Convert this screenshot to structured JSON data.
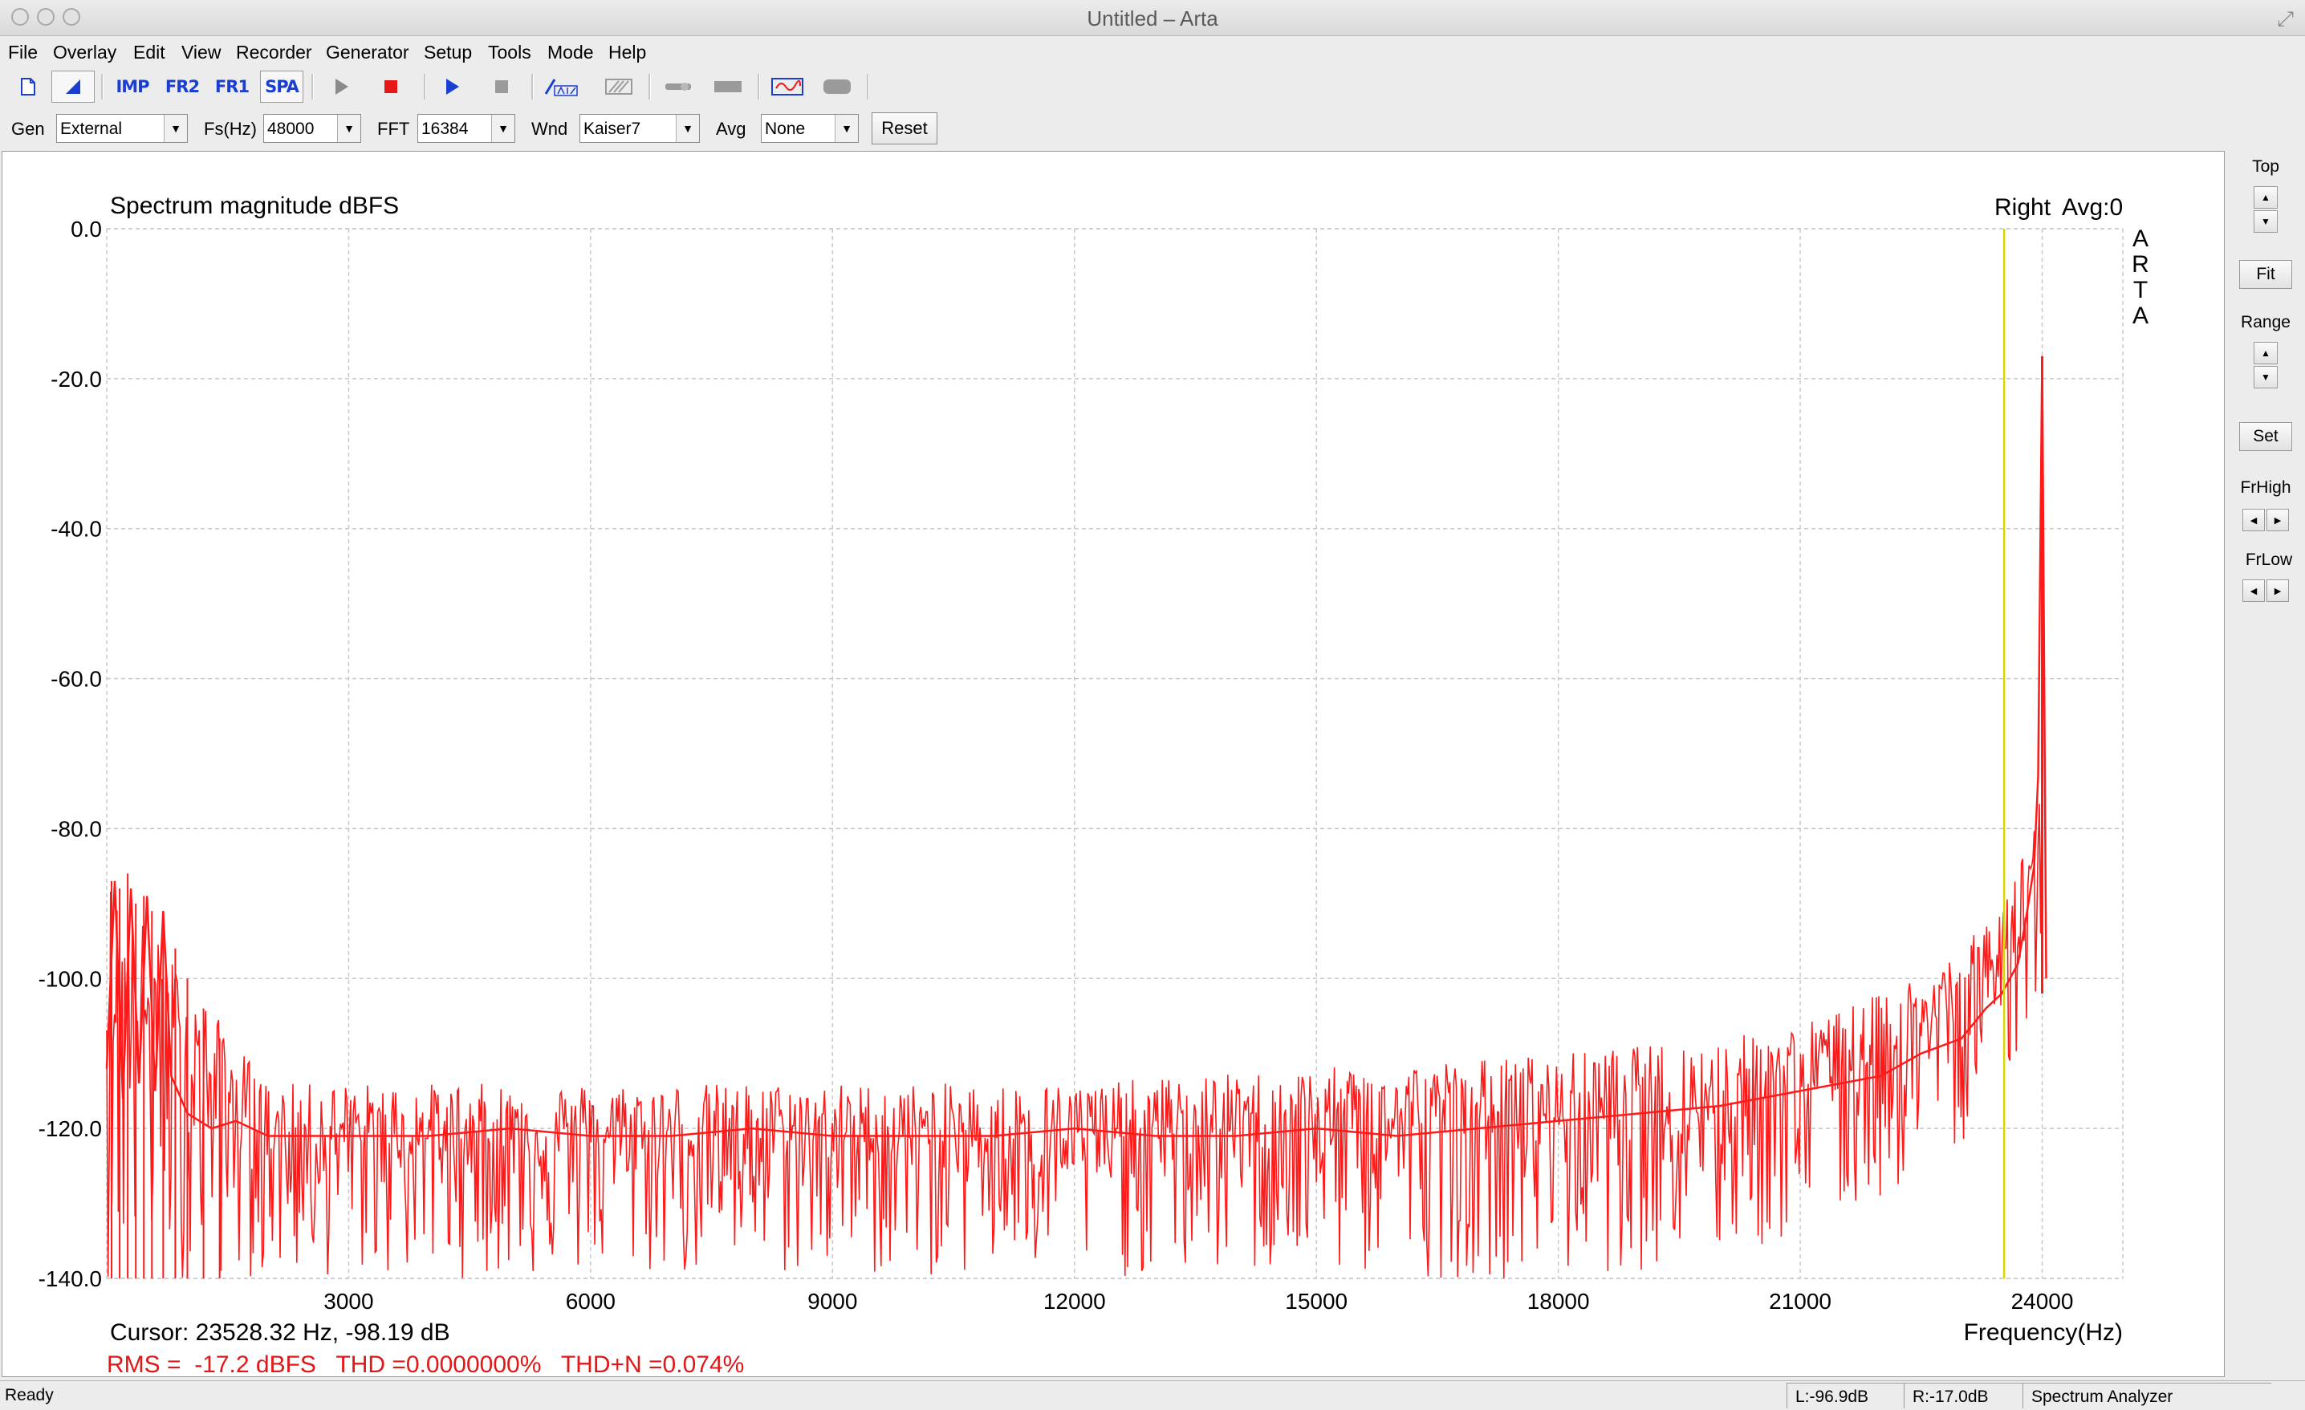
{
  "window": {
    "title": "Untitled – Arta"
  },
  "menubar": {
    "items": [
      "File",
      "Overlay",
      "Edit",
      "View",
      "Recorder",
      "Generator",
      "Setup",
      "Tools",
      "Mode",
      "Help"
    ]
  },
  "toolbar": {
    "imp": "IMP",
    "fr2": "FR2",
    "fr1": "FR1",
    "spa": "SPA"
  },
  "params": {
    "gen_label": "Gen",
    "gen_value": "External",
    "fs_label": "Fs(Hz)",
    "fs_value": "48000",
    "fft_label": "FFT",
    "fft_value": "16384",
    "wnd_label": "Wnd",
    "wnd_value": "Kaiser7",
    "avg_label": "Avg",
    "avg_value": "None",
    "reset_label": "Reset"
  },
  "side": {
    "top_label": "Top",
    "fit_label": "Fit",
    "range_label": "Range",
    "set_label": "Set",
    "frhigh_label": "FrHigh",
    "frlow_label": "FrLow"
  },
  "chart_data": {
    "type": "line",
    "title": "Spectrum magnitude dBFS",
    "channel_label": "Right",
    "avg_label": "Avg:0",
    "watermark": "ARTA",
    "xlabel": "Frequency(Hz)",
    "ylabel": "",
    "xlim": [
      0,
      25000
    ],
    "ylim": [
      -140,
      0
    ],
    "xticks": [
      3000,
      6000,
      9000,
      12000,
      15000,
      18000,
      21000,
      24000
    ],
    "yticks": [
      0,
      -20,
      -40,
      -60,
      -80,
      -100,
      -120,
      -140
    ],
    "ytick_labels": [
      "0.0",
      "-20.0",
      "-40.0",
      "-60.0",
      "-80.0",
      "-100.0",
      "-120.0",
      "-140.0"
    ],
    "grid": true,
    "cursor_freq": 23528.32,
    "series": [
      {
        "color": "#ff1a1a",
        "x": [
          0,
          100,
          200,
          300,
          400,
          500,
          600,
          700,
          800,
          1000,
          1300,
          1600,
          2000,
          3000,
          4000,
          5000,
          6000,
          7000,
          8000,
          9000,
          10000,
          11000,
          12000,
          13000,
          14000,
          15000,
          16000,
          17000,
          18000,
          19000,
          20000,
          21000,
          22000,
          22500,
          23000,
          23300,
          23500,
          23700,
          23800,
          23900,
          23950,
          24000,
          24050
        ],
        "values": [
          -112,
          -87,
          -116,
          -88,
          -114,
          -89,
          -115,
          -91,
          -113,
          -118,
          -120,
          -119,
          -121,
          -121,
          -121,
          -120,
          -121,
          -121,
          -120,
          -121,
          -121,
          -121,
          -120,
          -121,
          -121,
          -120,
          -121,
          -120,
          -119,
          -118,
          -117,
          -115,
          -113,
          -110,
          -108,
          -104,
          -102,
          -98,
          -92,
          -85,
          -73,
          -17,
          -100
        ]
      }
    ],
    "noise_envelope": {
      "x": [
        0,
        1000,
        2000,
        6000,
        12000,
        18000,
        20000,
        21000,
        22000,
        22500,
        23000,
        23500,
        23900,
        24000
      ],
      "upper": [
        -86,
        -100,
        -114,
        -114,
        -114,
        -110,
        -108,
        -106,
        -102,
        -99,
        -96,
        -90,
        -78,
        -72
      ],
      "lower": [
        -140,
        -140,
        -140,
        -140,
        -140,
        -140,
        -138,
        -135,
        -130,
        -126,
        -122,
        -115,
        -105,
        -102
      ]
    },
    "cursor_text": "Cursor: 23528.32 Hz, -98.19 dB",
    "measurement_text": "RMS =  -17.2 dBFS   THD =0.0000000%   THD+N =0.074%"
  },
  "status": {
    "ready": "Ready",
    "left_level": "L:-96.9dB",
    "right_level": "R:-17.0dB",
    "mode": "Spectrum Analyzer"
  },
  "colors": {
    "trace": "#ff1a1a",
    "cursor": "#d8d800",
    "grid": "#c8c8c8",
    "measurement_text": "#e01818",
    "toolbar_blue": "#1a3fd0"
  }
}
